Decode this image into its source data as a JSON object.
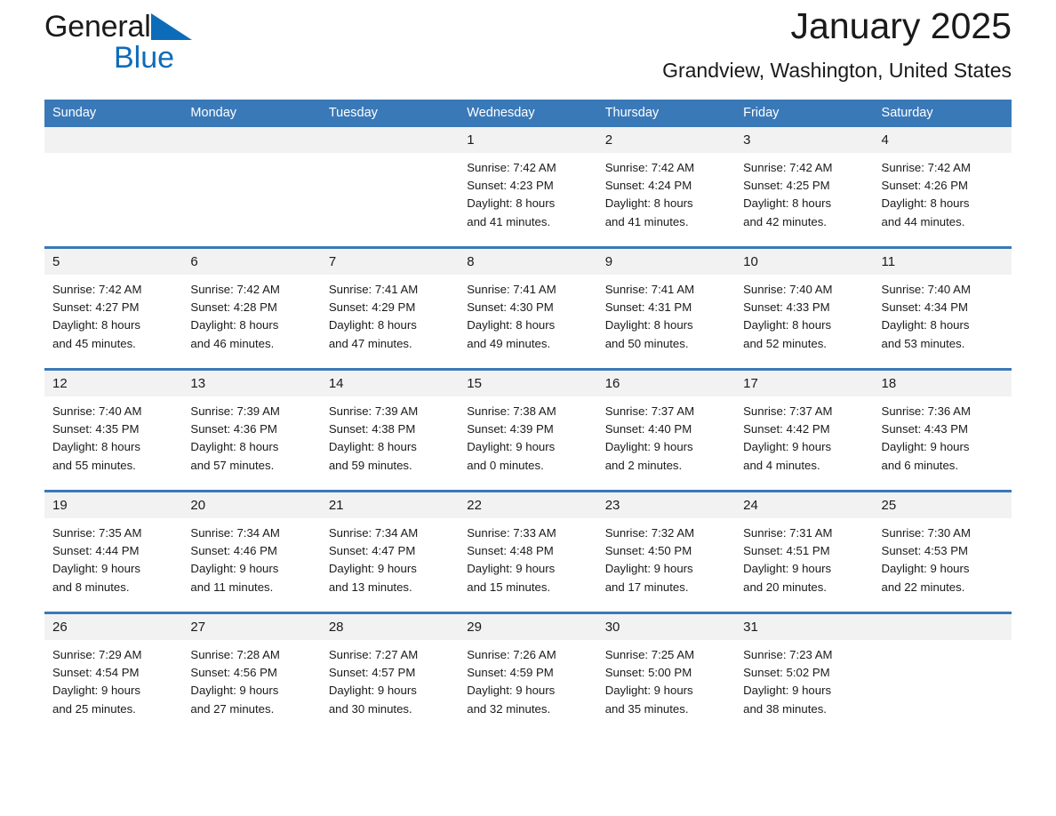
{
  "brand": {
    "name_part1": "General",
    "name_part2": "Blue",
    "triangle_icon": "triangle-icon",
    "accent_color": "#0d6cb9"
  },
  "header": {
    "title": "January 2025",
    "subtitle": "Grandview, Washington, United States"
  },
  "calendar": {
    "header_bg": "#3a79b8",
    "daynum_bg": "#f2f2f2",
    "weekday_headers": [
      "Sunday",
      "Monday",
      "Tuesday",
      "Wednesday",
      "Thursday",
      "Friday",
      "Saturday"
    ],
    "weeks": [
      [
        {
          "day": "",
          "empty": true
        },
        {
          "day": "",
          "empty": true
        },
        {
          "day": "",
          "empty": true
        },
        {
          "day": "1",
          "sunrise": "Sunrise: 7:42 AM",
          "sunset": "Sunset: 4:23 PM",
          "daylight_line1": "Daylight: 8 hours",
          "daylight_line2": "and 41 minutes."
        },
        {
          "day": "2",
          "sunrise": "Sunrise: 7:42 AM",
          "sunset": "Sunset: 4:24 PM",
          "daylight_line1": "Daylight: 8 hours",
          "daylight_line2": "and 41 minutes."
        },
        {
          "day": "3",
          "sunrise": "Sunrise: 7:42 AM",
          "sunset": "Sunset: 4:25 PM",
          "daylight_line1": "Daylight: 8 hours",
          "daylight_line2": "and 42 minutes."
        },
        {
          "day": "4",
          "sunrise": "Sunrise: 7:42 AM",
          "sunset": "Sunset: 4:26 PM",
          "daylight_line1": "Daylight: 8 hours",
          "daylight_line2": "and 44 minutes."
        }
      ],
      [
        {
          "day": "5",
          "sunrise": "Sunrise: 7:42 AM",
          "sunset": "Sunset: 4:27 PM",
          "daylight_line1": "Daylight: 8 hours",
          "daylight_line2": "and 45 minutes."
        },
        {
          "day": "6",
          "sunrise": "Sunrise: 7:42 AM",
          "sunset": "Sunset: 4:28 PM",
          "daylight_line1": "Daylight: 8 hours",
          "daylight_line2": "and 46 minutes."
        },
        {
          "day": "7",
          "sunrise": "Sunrise: 7:41 AM",
          "sunset": "Sunset: 4:29 PM",
          "daylight_line1": "Daylight: 8 hours",
          "daylight_line2": "and 47 minutes."
        },
        {
          "day": "8",
          "sunrise": "Sunrise: 7:41 AM",
          "sunset": "Sunset: 4:30 PM",
          "daylight_line1": "Daylight: 8 hours",
          "daylight_line2": "and 49 minutes."
        },
        {
          "day": "9",
          "sunrise": "Sunrise: 7:41 AM",
          "sunset": "Sunset: 4:31 PM",
          "daylight_line1": "Daylight: 8 hours",
          "daylight_line2": "and 50 minutes."
        },
        {
          "day": "10",
          "sunrise": "Sunrise: 7:40 AM",
          "sunset": "Sunset: 4:33 PM",
          "daylight_line1": "Daylight: 8 hours",
          "daylight_line2": "and 52 minutes."
        },
        {
          "day": "11",
          "sunrise": "Sunrise: 7:40 AM",
          "sunset": "Sunset: 4:34 PM",
          "daylight_line1": "Daylight: 8 hours",
          "daylight_line2": "and 53 minutes."
        }
      ],
      [
        {
          "day": "12",
          "sunrise": "Sunrise: 7:40 AM",
          "sunset": "Sunset: 4:35 PM",
          "daylight_line1": "Daylight: 8 hours",
          "daylight_line2": "and 55 minutes."
        },
        {
          "day": "13",
          "sunrise": "Sunrise: 7:39 AM",
          "sunset": "Sunset: 4:36 PM",
          "daylight_line1": "Daylight: 8 hours",
          "daylight_line2": "and 57 minutes."
        },
        {
          "day": "14",
          "sunrise": "Sunrise: 7:39 AM",
          "sunset": "Sunset: 4:38 PM",
          "daylight_line1": "Daylight: 8 hours",
          "daylight_line2": "and 59 minutes."
        },
        {
          "day": "15",
          "sunrise": "Sunrise: 7:38 AM",
          "sunset": "Sunset: 4:39 PM",
          "daylight_line1": "Daylight: 9 hours",
          "daylight_line2": "and 0 minutes."
        },
        {
          "day": "16",
          "sunrise": "Sunrise: 7:37 AM",
          "sunset": "Sunset: 4:40 PM",
          "daylight_line1": "Daylight: 9 hours",
          "daylight_line2": "and 2 minutes."
        },
        {
          "day": "17",
          "sunrise": "Sunrise: 7:37 AM",
          "sunset": "Sunset: 4:42 PM",
          "daylight_line1": "Daylight: 9 hours",
          "daylight_line2": "and 4 minutes."
        },
        {
          "day": "18",
          "sunrise": "Sunrise: 7:36 AM",
          "sunset": "Sunset: 4:43 PM",
          "daylight_line1": "Daylight: 9 hours",
          "daylight_line2": "and 6 minutes."
        }
      ],
      [
        {
          "day": "19",
          "sunrise": "Sunrise: 7:35 AM",
          "sunset": "Sunset: 4:44 PM",
          "daylight_line1": "Daylight: 9 hours",
          "daylight_line2": "and 8 minutes."
        },
        {
          "day": "20",
          "sunrise": "Sunrise: 7:34 AM",
          "sunset": "Sunset: 4:46 PM",
          "daylight_line1": "Daylight: 9 hours",
          "daylight_line2": "and 11 minutes."
        },
        {
          "day": "21",
          "sunrise": "Sunrise: 7:34 AM",
          "sunset": "Sunset: 4:47 PM",
          "daylight_line1": "Daylight: 9 hours",
          "daylight_line2": "and 13 minutes."
        },
        {
          "day": "22",
          "sunrise": "Sunrise: 7:33 AM",
          "sunset": "Sunset: 4:48 PM",
          "daylight_line1": "Daylight: 9 hours",
          "daylight_line2": "and 15 minutes."
        },
        {
          "day": "23",
          "sunrise": "Sunrise: 7:32 AM",
          "sunset": "Sunset: 4:50 PM",
          "daylight_line1": "Daylight: 9 hours",
          "daylight_line2": "and 17 minutes."
        },
        {
          "day": "24",
          "sunrise": "Sunrise: 7:31 AM",
          "sunset": "Sunset: 4:51 PM",
          "daylight_line1": "Daylight: 9 hours",
          "daylight_line2": "and 20 minutes."
        },
        {
          "day": "25",
          "sunrise": "Sunrise: 7:30 AM",
          "sunset": "Sunset: 4:53 PM",
          "daylight_line1": "Daylight: 9 hours",
          "daylight_line2": "and 22 minutes."
        }
      ],
      [
        {
          "day": "26",
          "sunrise": "Sunrise: 7:29 AM",
          "sunset": "Sunset: 4:54 PM",
          "daylight_line1": "Daylight: 9 hours",
          "daylight_line2": "and 25 minutes."
        },
        {
          "day": "27",
          "sunrise": "Sunrise: 7:28 AM",
          "sunset": "Sunset: 4:56 PM",
          "daylight_line1": "Daylight: 9 hours",
          "daylight_line2": "and 27 minutes."
        },
        {
          "day": "28",
          "sunrise": "Sunrise: 7:27 AM",
          "sunset": "Sunset: 4:57 PM",
          "daylight_line1": "Daylight: 9 hours",
          "daylight_line2": "and 30 minutes."
        },
        {
          "day": "29",
          "sunrise": "Sunrise: 7:26 AM",
          "sunset": "Sunset: 4:59 PM",
          "daylight_line1": "Daylight: 9 hours",
          "daylight_line2": "and 32 minutes."
        },
        {
          "day": "30",
          "sunrise": "Sunrise: 7:25 AM",
          "sunset": "Sunset: 5:00 PM",
          "daylight_line1": "Daylight: 9 hours",
          "daylight_line2": "and 35 minutes."
        },
        {
          "day": "31",
          "sunrise": "Sunrise: 7:23 AM",
          "sunset": "Sunset: 5:02 PM",
          "daylight_line1": "Daylight: 9 hours",
          "daylight_line2": "and 38 minutes."
        },
        {
          "day": "",
          "empty": true
        }
      ]
    ]
  }
}
